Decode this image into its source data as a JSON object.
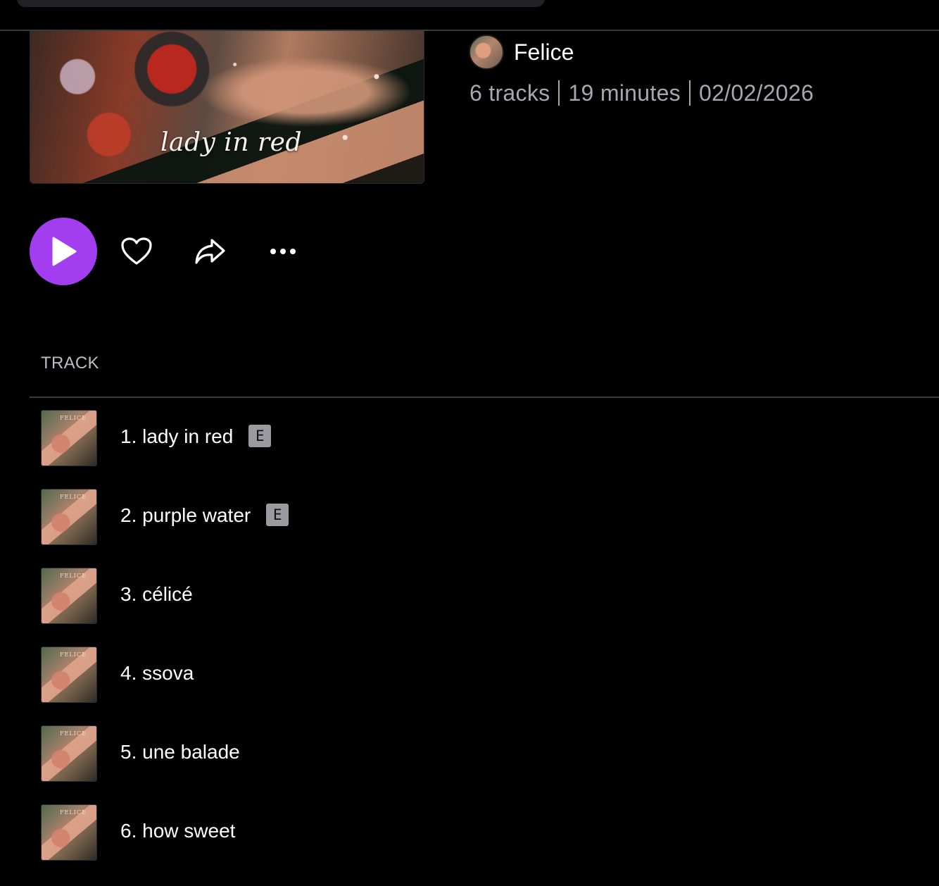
{
  "album": {
    "cover_text": "lady in red",
    "artist_name": "Felice",
    "track_count": "6 tracks",
    "duration": "19 minutes",
    "release_date": "02/02/2026"
  },
  "actions": {
    "play_icon": "play-icon",
    "like_icon": "heart-icon",
    "share_icon": "share-icon",
    "more_icon": "more-icon"
  },
  "list": {
    "header": "TRACK",
    "explicit_label": "E",
    "thumb_text": "FELICE",
    "tracks": [
      {
        "title": "1. lady in red",
        "explicit": true
      },
      {
        "title": "2. purple water",
        "explicit": true
      },
      {
        "title": "3. célicé",
        "explicit": false
      },
      {
        "title": "4. ssova",
        "explicit": false
      },
      {
        "title": "5. une balade",
        "explicit": false
      },
      {
        "title": "6. how sweet",
        "explicit": false
      }
    ]
  },
  "colors": {
    "accent": "#a23ef0",
    "background": "#000000",
    "muted_text": "#a8a8ac"
  }
}
